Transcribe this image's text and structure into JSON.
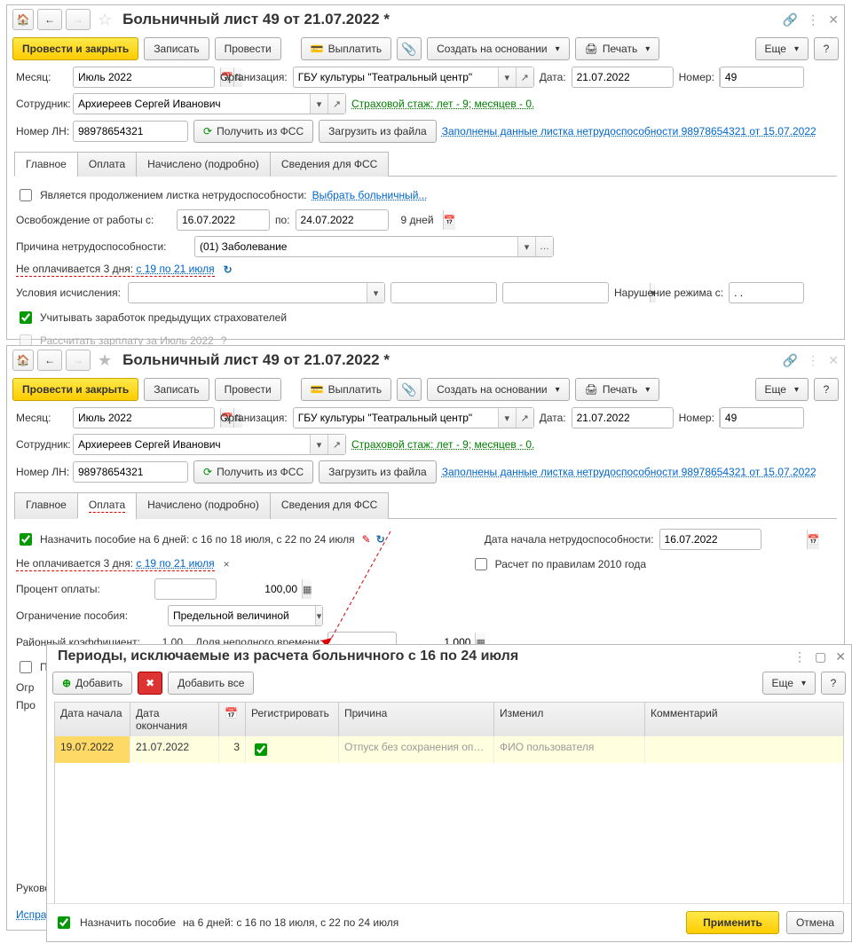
{
  "w1": {
    "title": "Больничный лист 49 от 21.07.2022 *",
    "toolbar": {
      "post_close": "Провести и закрыть",
      "save": "Записать",
      "post": "Провести",
      "pay": "Выплатить",
      "create_based": "Создать на основании",
      "print": "Печать",
      "more": "Еще",
      "help": "?"
    },
    "month_lbl": "Месяц:",
    "month_val": "Июль 2022",
    "org_lbl": "Организация:",
    "org_val": "ГБУ культуры \"Театральный центр\"",
    "date_lbl": "Дата:",
    "date_val": "21.07.2022",
    "number_lbl": "Номер:",
    "number_val": "49",
    "emp_lbl": "Сотрудник:",
    "emp_val": "Архиереев Сергей Иванович",
    "stazh_link": "Страховой стаж: лет - 9; месяцев - 0.",
    "ln_lbl": "Номер ЛН:",
    "ln_val": "98978654321",
    "get_fss": "Получить из ФСС",
    "load_file": "Загрузить из файла",
    "filled_link": "Заполнены данные листка нетрудоспособности 98978654321 от 15.07.2022",
    "tabs": {
      "main": "Главное",
      "pay": "Оплата",
      "accr": "Начислено (подробно)",
      "fss": "Сведения для ФСС"
    },
    "main_tab": {
      "is_continuation": "Является продолжением листка нетрудоспособности:",
      "select_bl": "Выбрать больничный...",
      "release_from": "Освобождение от работы с:",
      "date_from": "16.07.2022",
      "to": "по:",
      "date_to": "24.07.2022",
      "days": "9 дней",
      "reason_lbl": "Причина нетрудоспособности:",
      "reason_val": "(01) Заболевание",
      "not_paid": "Не оплачивается 3 дня:",
      "not_paid_link": "с 19 по 21 июля",
      "cond_lbl": "Условия исчисления:",
      "violation_lbl": "Нарушение режима с:",
      "violation_val": ". .",
      "prev_ins": "Учитывать заработок предыдущих страхователей",
      "calc_salary": "Рассчитать зарплату за Июль 2022"
    }
  },
  "w2": {
    "title": "Больничный лист 49 от 21.07.2022 *",
    "tabs_active": "Оплата",
    "pay_tab": {
      "assign_chk": "Назначить пособие на 6 дней: с 16 по 18 июля, с 22 по 24 июля",
      "not_paid": "Не оплачивается 3 дня:",
      "not_paid_link": "с 19 по 21 июля",
      "start_lbl": "Дата начала нетрудоспособности:",
      "start_val": "16.07.2022",
      "rules2010": "Расчет по правилам 2010 года",
      "percent_lbl": "Процент оплаты:",
      "percent_val": "100,00",
      "limit_lbl": "Ограничение пособия:",
      "limit_val": "Предельной величиной",
      "coef_lbl": "Районный коэффициент:",
      "coef_val": "1,00",
      "share_lbl": "Доля неполного времени:",
      "share_val": "1,000"
    },
    "cut_labels": {
      "p": "П",
      "ogr": "Огр",
      "pro": "Про",
      "ruk": "Руковс",
      "isp": "Испра"
    }
  },
  "w3": {
    "title": "Периоды, исключаемые из расчета больничного с 16 по 24 июля",
    "add": "Добавить",
    "add_all": "Добавить все",
    "more": "Еще",
    "help": "?",
    "cols": {
      "start": "Дата начала",
      "end": "Дата окончания",
      "cal": "",
      "reg": "Регистрировать",
      "reason": "Причина",
      "changed": "Изменил",
      "comment": "Комментарий"
    },
    "row": {
      "start": "19.07.2022",
      "end": "21.07.2022",
      "days": "3",
      "reason": "Отпуск без сохранения оп…",
      "changed": "ФИО пользователя"
    },
    "footer_chk": "Назначить пособие",
    "footer_txt": "на 6 дней: с 16 по 18 июля, с 22 по 24 июля",
    "apply": "Применить",
    "cancel": "Отмена"
  }
}
